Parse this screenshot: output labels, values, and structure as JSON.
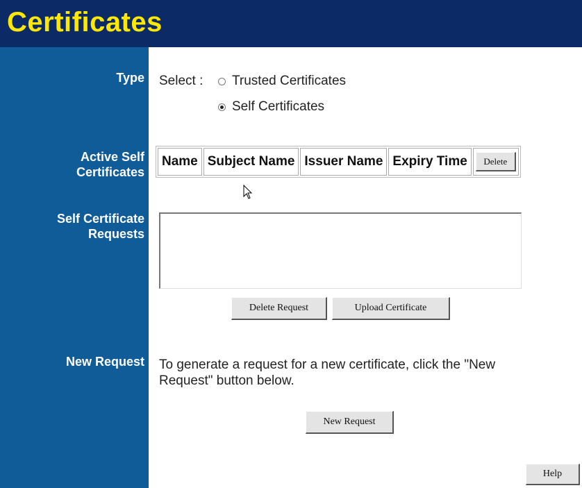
{
  "header": {
    "title": "Certificates"
  },
  "sidebar": {
    "type_label": "Type",
    "active_label_1": "Active Self",
    "active_label_2": "Certificates",
    "requests_label_1": "Self Certificate",
    "requests_label_2": "Requests",
    "new_request_label": "New Request"
  },
  "type_section": {
    "select_label": "Select :",
    "options": [
      "Trusted Certificates",
      "Self Certificates"
    ],
    "selected": "Self Certificates"
  },
  "active_table": {
    "columns": [
      "Name",
      "Subject Name",
      "Issuer Name",
      "Expiry Time"
    ],
    "delete_label": "Delete"
  },
  "requests_section": {
    "delete_request_label": "Delete Request",
    "upload_label": "Upload Certificate"
  },
  "new_request_section": {
    "description_line1": "To generate a request for a new certificate, click the \"New",
    "description_line2": "Request\" button below.",
    "button_label": "New Request"
  },
  "help_label": "Help",
  "colors": {
    "header_bg": "#0b2a66",
    "title": "#ffe800",
    "sidebar_bg": "#0f5c99"
  }
}
